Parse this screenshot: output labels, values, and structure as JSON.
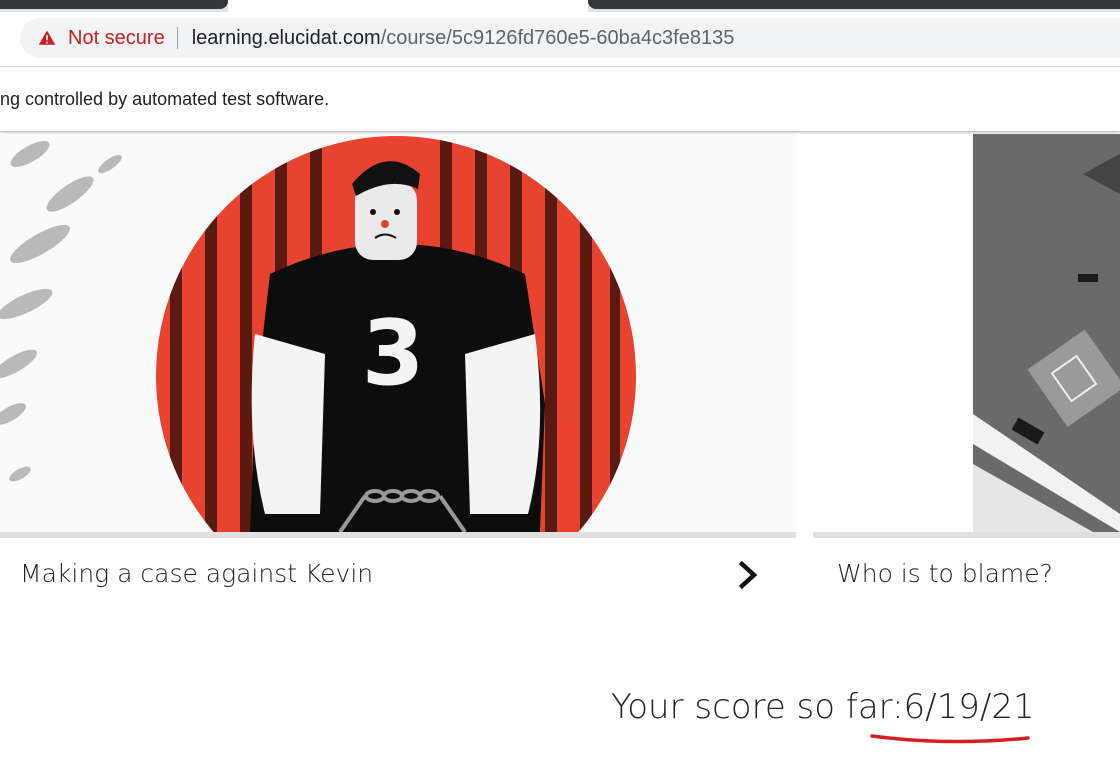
{
  "browser": {
    "security_label": "Not secure",
    "url_domain": "learning.elucidat.com",
    "url_path": "/course/5c9126fd760e5-60ba4c3fe8135",
    "infobar_text": "ng controlled by automated test software."
  },
  "cards": [
    {
      "title": "Making a case against Kevin",
      "jersey_number": "3"
    },
    {
      "title": "Who is to blame?"
    }
  ],
  "score": {
    "label": "Your score so far:",
    "value": "6/19/21"
  },
  "colors": {
    "not_secure": "#c5221f",
    "illustration_red": "#e8432f",
    "annotation_underline": "#d62020"
  },
  "icons": [
    "warning-icon",
    "chevron-right-icon"
  ]
}
